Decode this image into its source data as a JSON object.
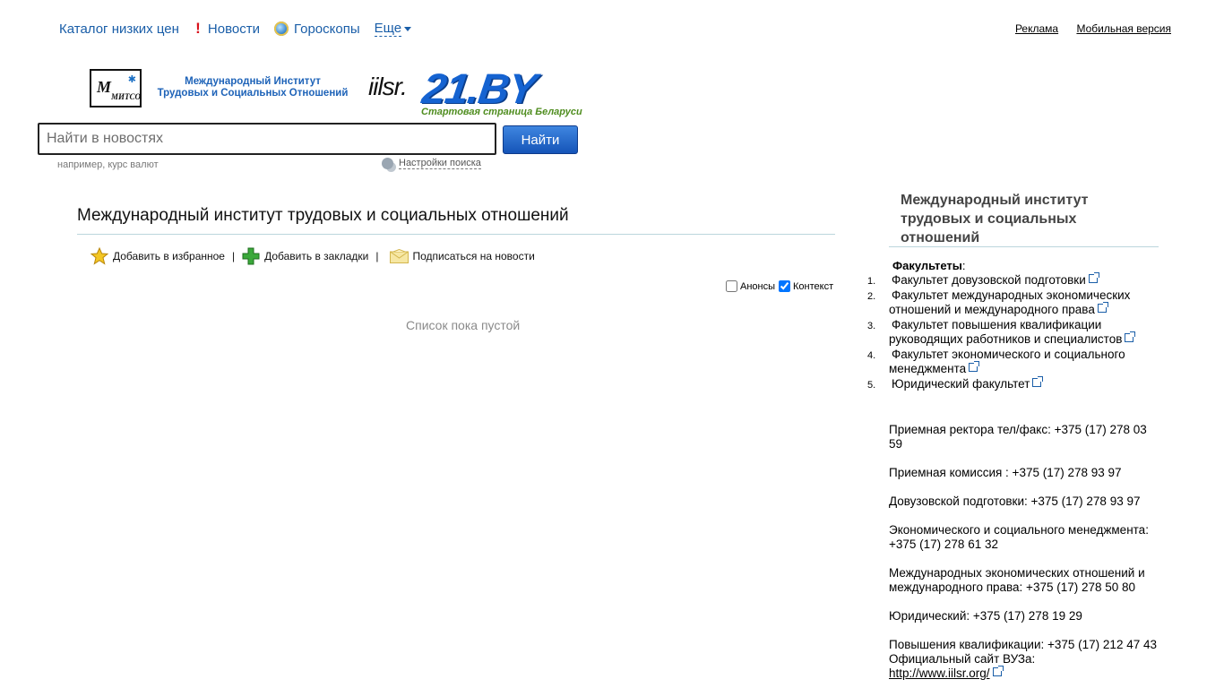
{
  "topnav": {
    "catalog": "Каталог низких цен",
    "news": "Новости",
    "horoscopes": "Гороскопы",
    "more": "Еще"
  },
  "toplinks": {
    "ads": "Реклама",
    "mobile": "Мобильная версия"
  },
  "logo": {
    "mitso_letters": "МИТСО",
    "institute_line1": "Международный Институт",
    "institute_line2": "Трудовых и Социальных Отношений",
    "iilsr": "iilsr.",
    "brand": "21.BY",
    "tagline": "Стартовая страница Беларуси"
  },
  "search": {
    "placeholder": "Найти в новостях",
    "button": "Найти",
    "hint": "например, курс валют",
    "settings": "Настройки поиска"
  },
  "main": {
    "title": "Международный институт трудовых и социальных отношений",
    "actions": {
      "favorite": "Добавить в избранное",
      "bookmarks": "Добавить в закладки",
      "subscribe": "Подписаться на новости"
    },
    "filters": {
      "announcements": "Анонсы",
      "announcements_checked": false,
      "context": "Контекст",
      "context_checked": true
    },
    "empty": "Список пока пустой"
  },
  "sidebar": {
    "title": "Международный институт трудовых и социальных отношений",
    "faculties_heading": "Факультеты",
    "faculties_colon": ":",
    "faculties": [
      {
        "num": "1.",
        "name": "Факультет довузовской подготовки"
      },
      {
        "num": "2.",
        "name": "Факультет международных экономических отношений и международного права"
      },
      {
        "num": "3.",
        "name": "Факультет повышения квалификации руководящих работников и специалистов"
      },
      {
        "num": "4.",
        "name": "Факультет экономического и социального менеджмента"
      },
      {
        "num": "5.",
        "name": "Юридический факультет"
      }
    ],
    "contacts": [
      "Приемная ректора тел/факс: +375 (17) 278 03 59",
      "Приемная комиссия : +375 (17) 278 93 97",
      "Довузовской подготовки: +375 (17) 278 93 97",
      "Экономического и социального менеджмента: +375 (17) 278 61 32",
      "Международных экономических отношений и международного права: +375 (17) 278 50 80",
      "Юридический: +375 (17) 278 19 29",
      "Повышения квалификации: +375 (17) 212 47 43"
    ],
    "site_label": "Официальный сайт ВУЗа:",
    "site_url": "http://www.iilsr.org/"
  },
  "colors": {
    "link": "#1a5ea8",
    "brand_blue": "#1563d1",
    "tagline_green": "#4f8d1f",
    "button_blue": "#1554b8"
  }
}
